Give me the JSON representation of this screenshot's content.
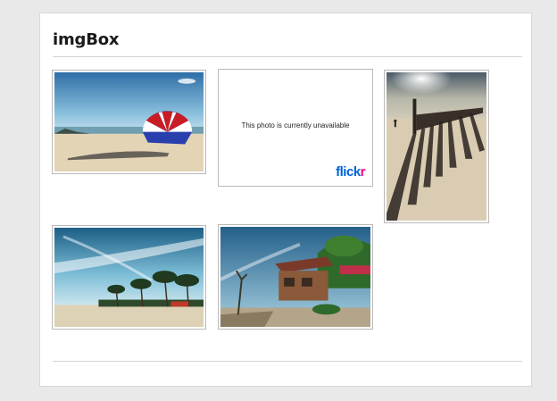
{
  "app": {
    "title": "imgBox"
  },
  "gallery": {
    "unavailable": {
      "message": "This photo is currently unavailable",
      "brand_part1": "flick",
      "brand_part2": "r"
    }
  },
  "colors": {
    "page_background": "#e9e9e9",
    "card_background": "#ffffff",
    "flickr_blue": "#0063dc",
    "flickr_pink": "#ff0084"
  }
}
